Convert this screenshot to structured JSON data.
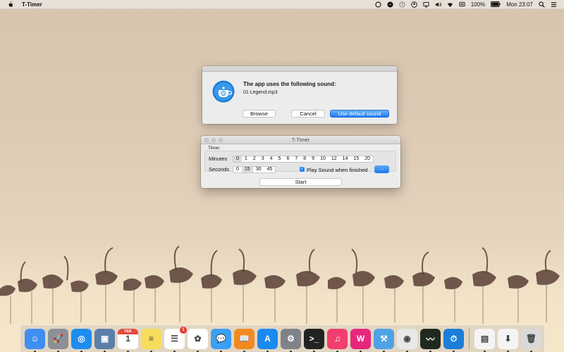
{
  "menubar": {
    "app_name": "T-Timer",
    "battery": "100%",
    "clock": "Mon 23:07",
    "icons": [
      "apple-icon",
      "creative-cloud-icon",
      "messenger-icon",
      "time-machine-icon",
      "user-icon",
      "airplay-icon",
      "volume-icon",
      "wifi-icon",
      "display-icon",
      "battery-icon",
      "search-icon",
      "control-menu-icon"
    ]
  },
  "dialog": {
    "title": "The app uses the following sound:",
    "filename": "01 Legend.mp3",
    "browse_label": "Browse",
    "cancel_label": "Cancel",
    "default_label": "Use default sound",
    "icon": "teapot-timer-icon"
  },
  "window": {
    "title": "T-Timer",
    "group_label": "Timer",
    "minutes_label": "Minutes",
    "minutes_options": [
      "0",
      "1",
      "2",
      "3",
      "4",
      "5",
      "6",
      "7",
      "8",
      "9",
      "10",
      "12",
      "14",
      "15",
      "20"
    ],
    "minutes_selected": "0",
    "seconds_label": "Seconds",
    "seconds_options": [
      "0",
      "15",
      "30",
      "45"
    ],
    "seconds_selected": "15",
    "play_sound_label": "Play Sound when finished",
    "play_sound_checked": true,
    "more_label": "...",
    "start_label": "Start"
  },
  "dock": {
    "items": [
      {
        "name": "finder",
        "color": "#3f8ef0",
        "glyph": "☺"
      },
      {
        "name": "launchpad",
        "color": "#8c8f96",
        "glyph": "🚀"
      },
      {
        "name": "safari",
        "color": "#1f8cf0",
        "glyph": "◎"
      },
      {
        "name": "preview",
        "color": "#5b7fa8",
        "glyph": "▣"
      },
      {
        "name": "calendar",
        "color": "#ffffff",
        "glyph": "1",
        "label_top": "FEB"
      },
      {
        "name": "notes",
        "color": "#f7dd5b",
        "glyph": "≡"
      },
      {
        "name": "reminders",
        "color": "#ffffff",
        "glyph": "☰",
        "badge": "1"
      },
      {
        "name": "photos",
        "color": "#ffffff",
        "glyph": "✿"
      },
      {
        "name": "messages",
        "color": "#3aa0f5",
        "glyph": "💬"
      },
      {
        "name": "ibooks",
        "color": "#f18b1f",
        "glyph": "📖"
      },
      {
        "name": "app-store",
        "color": "#1b8af0",
        "glyph": "A"
      },
      {
        "name": "system-preferences",
        "color": "#7f8389",
        "glyph": "⚙"
      },
      {
        "name": "terminal",
        "color": "#222222",
        "glyph": ">_"
      },
      {
        "name": "itunes",
        "color": "#f03f6e",
        "glyph": "♫"
      },
      {
        "name": "wunderbucket",
        "color": "#e6277c",
        "glyph": "W"
      },
      {
        "name": "xcode",
        "color": "#4fa2e4",
        "glyph": "⚒"
      },
      {
        "name": "chrome",
        "color": "#e8e8e8",
        "glyph": "◉"
      },
      {
        "name": "activity-monitor",
        "color": "#1e2a1f",
        "glyph": "〰"
      },
      {
        "name": "t-timer",
        "color": "#1c7ed8",
        "glyph": "⏱"
      }
    ],
    "right_items": [
      {
        "name": "documents-stack",
        "color": "#f4f4f4",
        "glyph": "▤"
      },
      {
        "name": "downloads-stack",
        "color": "#f4f4f4",
        "glyph": "⬇"
      },
      {
        "name": "trash",
        "color": "#d9d9d9",
        "glyph": "🗑"
      }
    ]
  },
  "colors": {
    "accent": "#1d7cf2",
    "window_bg": "#ececec"
  }
}
